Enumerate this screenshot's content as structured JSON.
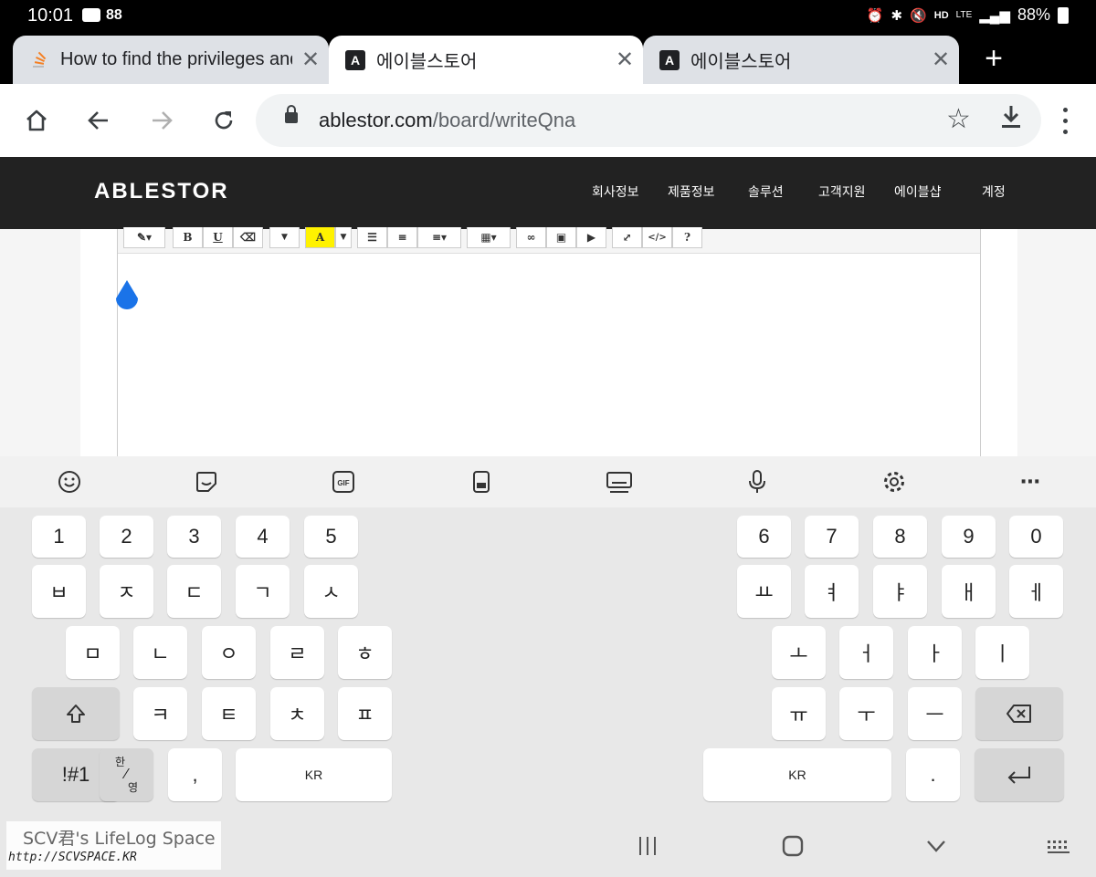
{
  "status": {
    "time": "10:01",
    "notif_count": "88",
    "battery": "88%",
    "net_label": "HD",
    "lte": "LTE"
  },
  "tabs": [
    {
      "title": "How to find the privileges and",
      "state": "inactive"
    },
    {
      "title": "에이블스토어",
      "state": "active"
    },
    {
      "title": "에이블스토어",
      "state": "inactive"
    }
  ],
  "toolbar": {
    "url_host": "ablestor.com",
    "url_path": "/board/writeQna"
  },
  "site": {
    "logo": "ABLESTOR",
    "nav": [
      "회사정보",
      "제품정보",
      "솔루션",
      "고객지원",
      "에이블샵",
      "계정"
    ]
  },
  "editor": {
    "buttons": [
      "B",
      "U",
      "A",
      "?"
    ]
  },
  "keyboard": {
    "numbers_left": [
      "1",
      "2",
      "3",
      "4",
      "5"
    ],
    "numbers_right": [
      "6",
      "7",
      "8",
      "9",
      "0"
    ],
    "row2_left": [
      "ㅂ",
      "ㅈ",
      "ㄷ",
      "ㄱ",
      "ㅅ"
    ],
    "row2_right": [
      "ㅛ",
      "ㅕ",
      "ㅑ",
      "ㅐ",
      "ㅔ"
    ],
    "row3_left": [
      "ㅁ",
      "ㄴ",
      "ㅇ",
      "ㄹ",
      "ㅎ"
    ],
    "row3_right": [
      "ㅗ",
      "ㅓ",
      "ㅏ",
      "ㅣ"
    ],
    "row4_left": [
      "ㅋ",
      "ㅌ",
      "ㅊ",
      "ㅍ"
    ],
    "row4_right": [
      "ㅠ",
      "ㅜ",
      "ㅡ"
    ],
    "symbols": "!#1",
    "lang_top": "한",
    "lang_bottom": "영",
    "comma": ",",
    "space_left": "KR",
    "space_right": "KR",
    "period": "."
  },
  "watermark": {
    "line1": "SCV君's LifeLog Space",
    "line2": "http://SCVSPACE.KR"
  }
}
